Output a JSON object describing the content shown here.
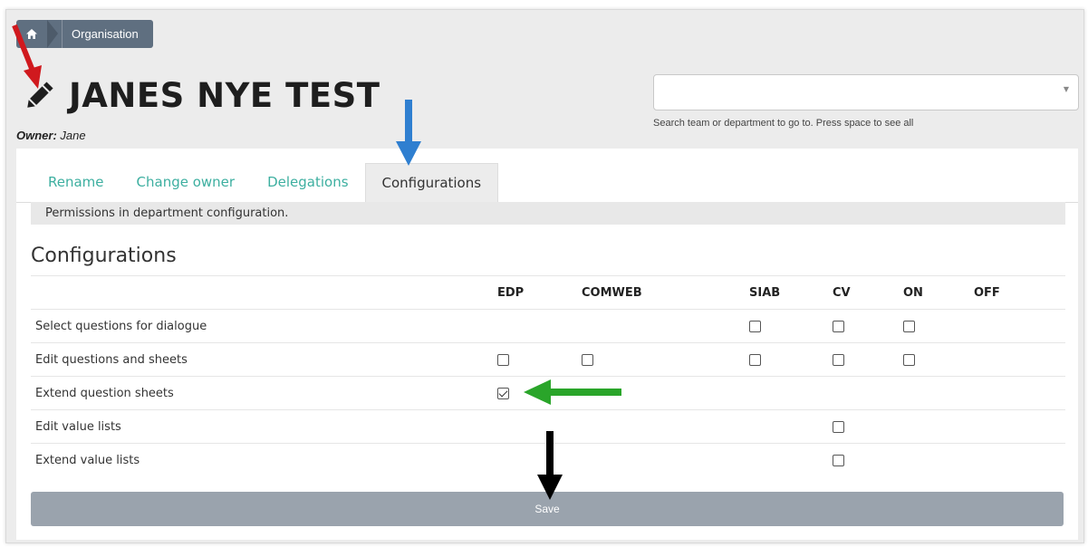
{
  "breadcrumb": {
    "home_icon": "home-icon",
    "current": "Organisation"
  },
  "page_title": "JANES NYE TEST",
  "owner": {
    "label": "Owner:",
    "value": "Jane"
  },
  "search": {
    "value": "",
    "help_text": "Search team or department to go to. Press space to see all"
  },
  "tabs": [
    {
      "label": "Rename",
      "active": false
    },
    {
      "label": "Change owner",
      "active": false
    },
    {
      "label": "Delegations",
      "active": false
    },
    {
      "label": "Configurations",
      "active": true
    }
  ],
  "tab_description": "Permissions in department configuration.",
  "section_title": "Configurations",
  "columns": [
    "EDP",
    "COMWEB",
    "SIAB",
    "CV",
    "ON",
    "OFF"
  ],
  "rows": [
    {
      "label": "Select questions for dialogue",
      "cells": [
        null,
        null,
        false,
        false,
        false,
        null
      ]
    },
    {
      "label": "Edit questions and sheets",
      "cells": [
        false,
        false,
        false,
        false,
        false,
        null
      ]
    },
    {
      "label": "Extend question sheets",
      "cells": [
        true,
        null,
        null,
        null,
        null,
        null
      ]
    },
    {
      "label": "Edit value lists",
      "cells": [
        null,
        null,
        null,
        false,
        null,
        null
      ]
    },
    {
      "label": "Extend value lists",
      "cells": [
        null,
        null,
        null,
        false,
        null,
        null
      ]
    }
  ],
  "save_label": "Save",
  "colors": {
    "accent_tab": "#3dafa0",
    "breadcrumb": "#5f6f80",
    "save_button": "#9aa3ad",
    "arrow_red": "#d0191e",
    "arrow_blue": "#2f7fd0",
    "arrow_green": "#2aa52a",
    "arrow_black": "#000000"
  }
}
